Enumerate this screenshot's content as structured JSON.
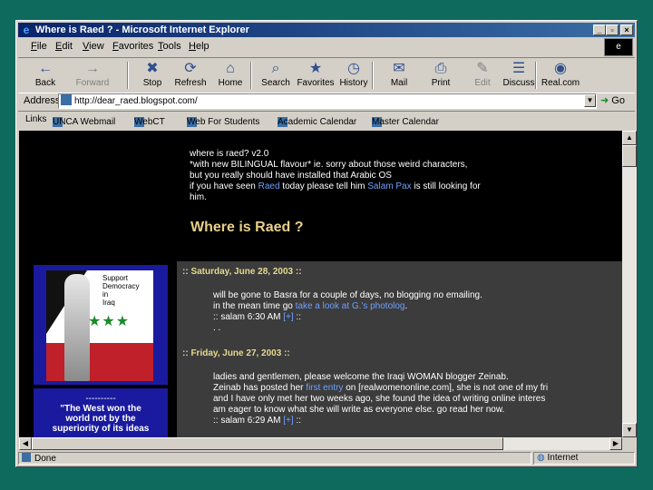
{
  "window": {
    "title": "Where is Raed ? - Microsoft Internet Explorer",
    "throbber": "e"
  },
  "menu": [
    "File",
    "Edit",
    "View",
    "Favorites",
    "Tools",
    "Help"
  ],
  "toolbar": [
    {
      "label": "Back",
      "icon": "back-arrow-icon",
      "glyph": "←"
    },
    {
      "label": "Forward",
      "icon": "forward-arrow-icon",
      "glyph": "→"
    },
    {
      "label": "Stop",
      "icon": "stop-icon",
      "glyph": "✖"
    },
    {
      "label": "Refresh",
      "icon": "refresh-icon",
      "glyph": "⟳"
    },
    {
      "label": "Home",
      "icon": "home-icon",
      "glyph": "⌂"
    },
    {
      "label": "Search",
      "icon": "search-icon",
      "glyph": "⌕"
    },
    {
      "label": "Favorites",
      "icon": "favorites-icon",
      "glyph": "★"
    },
    {
      "label": "History",
      "icon": "history-icon",
      "glyph": "◷"
    },
    {
      "label": "Mail",
      "icon": "mail-icon",
      "glyph": "✉"
    },
    {
      "label": "Print",
      "icon": "print-icon",
      "glyph": "⎙"
    },
    {
      "label": "Edit",
      "icon": "edit-icon",
      "glyph": "✎"
    },
    {
      "label": "Discuss",
      "icon": "discuss-icon",
      "glyph": "☰"
    },
    {
      "label": "Real.com",
      "icon": "realcom-icon",
      "glyph": "◉"
    }
  ],
  "address": {
    "label": "Address",
    "url": "http://dear_raed.blogspot.com/",
    "go": "Go"
  },
  "links": {
    "label": "Links",
    "items": [
      "UNCA Webmail",
      "WebCT",
      "Web For Students",
      "Academic Calendar",
      "Master Calendar"
    ]
  },
  "page": {
    "header_line1": "where is raed? v2.0",
    "header_line2": "*with new BILINGUAL flavour* ie. sorry about those weird characters,",
    "header_line3": "but you really should have installed that Arabic OS",
    "header_line4_pre": "if you have seen ",
    "header_line4_link1": "Raed",
    "header_line4_mid": " today please tell him ",
    "header_line4_link2": "Salam Pax",
    "header_line4_post": " is still looking for",
    "header_line5": "him.",
    "blog_title": "Where is Raed ?",
    "posts": [
      {
        "date": ":: Saturday, June 28, 2003 ::",
        "line1": "will be gone to Basra for a couple of days, no blogging no emailing.",
        "line2_pre": "in the mean time go ",
        "line2_link": "take a look at G.'s photolog",
        "line2_post": ".",
        "meta_pre": ":: salam 6:30 AM ",
        "meta_link": "[+]",
        "meta_post": " ::",
        "extra": ". ."
      },
      {
        "date": ":: Friday, June 27, 2003 ::",
        "line1": "ladies and gentlemen, please welcome the Iraqi WOMAN blogger Zeinab.",
        "line2_pre": "Zeinab has posted her ",
        "line2_link": "first entry",
        "line2_post": " on [realwomenonline.com], she is not one of my fri",
        "line3": "and I have only met her two weeks ago, she found the idea of writing online interes",
        "line4": "am eager to know what she will write as everyone else. go read her now.",
        "meta_pre": ":: salam 6:29 AM ",
        "meta_link": "[+]",
        "meta_post": " ::"
      }
    ],
    "sidebar": {
      "flag_text": [
        "Support",
        "Democracy",
        "in",
        "Iraq"
      ],
      "quote_dashes": "----------",
      "quote_lines": [
        "\"The West won the",
        "world not by the",
        "superiority of its ideas"
      ]
    }
  },
  "status": {
    "left": "Done",
    "zone": "Internet"
  }
}
